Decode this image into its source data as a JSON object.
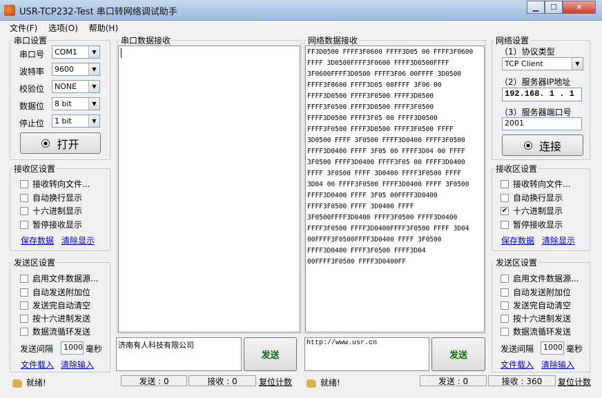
{
  "window": {
    "title": "USR-TCP232-Test 串口转网络调试助手",
    "buttons": {
      "minimize": "▁",
      "maximize": "☐",
      "close": "✕"
    }
  },
  "menu": [
    "文件(F)",
    "选项(O)",
    "帮助(H)"
  ],
  "serial_settings": {
    "title": "串口设置",
    "fields": [
      {
        "label": "串口号",
        "value": "COM1"
      },
      {
        "label": "波特率",
        "value": "9600"
      },
      {
        "label": "校验位",
        "value": "NONE"
      },
      {
        "label": "数据位",
        "value": "8 bit"
      },
      {
        "label": "停止位",
        "value": "1 bit"
      }
    ],
    "open_button": "打开"
  },
  "left_recv": {
    "title": "接收区设置",
    "options": [
      {
        "label": "接收转向文件...",
        "checked": false
      },
      {
        "label": "自动换行显示",
        "checked": false
      },
      {
        "label": "十六进制显示",
        "checked": false
      },
      {
        "label": "暂停接收显示",
        "checked": false
      }
    ],
    "save": "保存数据",
    "clear": "清除显示"
  },
  "left_send": {
    "title": "发送区设置",
    "options": [
      {
        "label": "启用文件数据源...",
        "checked": false
      },
      {
        "label": "自动发送附加位",
        "checked": false
      },
      {
        "label": "发送完自动清空",
        "checked": false
      },
      {
        "label": "按十六进制发送",
        "checked": false
      },
      {
        "label": "数据流循环发送",
        "checked": false
      }
    ],
    "interval_label": "发送间隔",
    "interval_value": "1000",
    "interval_unit": "毫秒",
    "load": "文件载入",
    "clear": "清除输入"
  },
  "serial_recv": {
    "title": "串口数据接收",
    "content": ""
  },
  "net_recv": {
    "title": "网络数据接收",
    "content": "FF3D0500 FFFF3F0600 FFFF3D05 00 FFFF3F0600\nFFFF 3D0500FFFF3F0600 FFFF3D0500FFFF\n3F0600FFFF3D0500 FFFF3F06 00FFFF 3D0500\nFFFF3F0600 FFFF3D05 00FFFF 3F06 00\nFFFF3D0500 FFFF3F0500 FFFF3D0500\nFFFF3F0500 FFFF3D0500 FFFF3F0500\nFFFF3D0500 FFFF3F05 00 FFFF3D0500\nFFFF3F0500 FFFF3D0500 FFFF3F0500 FFFF\n3D0500 FFFF 3F0500 FFFF3D0400 FFFF3F0500\nFFFF3D0400 FFFF 3F05 00 FFFF3D04 00 FFFF\n3F0500 FFFF3D0400 FFFF3F05 00 FFFF3D0400\nFFFF 3F0500 FFFF 3D0400 FFFF3F0500 FFFF\n3D04 00 FFFF3F0500 FFFF3D0400 FFFF 3F0500\nFFFF3D0400 FFFF 3F05 00FFFF3D0400\nFFFF3F0500 FFFF 3D0400 FFFF\n3F0500FFFF3D0400 FFFF3F0500 FFFF3D0400\nFFFF3F0500 FFFF3D0400FFFF3F0500 FFFF 3D04\n00FFFF3F0500FFFF3D0400 FFFF 3F0500\nFFFF3D0400 FFFF3F0500 FFFF3D04\n00FFFF3F0500 FFFF3D0400FF"
  },
  "serial_send": {
    "text": "济南有人科技有限公司",
    "button": "发送"
  },
  "net_send": {
    "text": "http://www.usr.cn",
    "button": "发送"
  },
  "net_settings": {
    "title": "网络设置",
    "protocol_label": "（1）协议类型",
    "protocol": "TCP Client",
    "ip_label": "（2）服务器IP地址",
    "ip": "192.168. 1 . 1",
    "port_label": "（3）服务器端口号",
    "port": "2001",
    "connect_button": "连接"
  },
  "right_recv": {
    "title": "接收区设置",
    "options": [
      {
        "label": "接收转向文件...",
        "checked": false
      },
      {
        "label": "自动换行显示",
        "checked": false
      },
      {
        "label": "十六进制显示",
        "checked": true
      },
      {
        "label": "暂停接收显示",
        "checked": false
      }
    ],
    "save": "保存数据",
    "clear": "清除显示"
  },
  "right_send": {
    "title": "发送区设置",
    "options": [
      {
        "label": "启用文件数据源...",
        "checked": false
      },
      {
        "label": "自动发送附加位",
        "checked": false
      },
      {
        "label": "发送完自动清空",
        "checked": false
      },
      {
        "label": "按十六进制发送",
        "checked": false
      },
      {
        "label": "数据流循环发送",
        "checked": false
      }
    ],
    "interval_label": "发送间隔",
    "interval_value": "1000",
    "interval_unit": "毫秒",
    "load": "文件载入",
    "clear": "清除输入"
  },
  "statusbar": {
    "left_ready": "就绪!",
    "left_sent": "发送 : 0",
    "left_recv": "接收 : 0",
    "left_reset": "复位计数",
    "right_ready": "就绪!",
    "right_sent": "发送 : 0",
    "right_recv": "接收 : 360",
    "right_reset": "复位计数"
  }
}
